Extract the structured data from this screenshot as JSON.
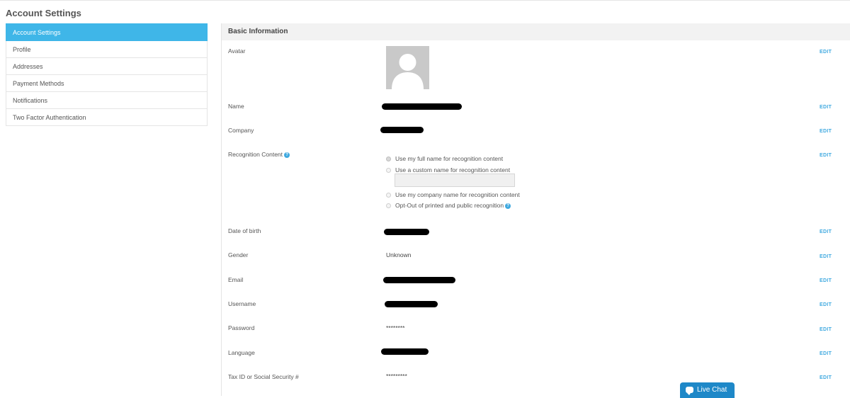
{
  "page": {
    "title": "Account Settings"
  },
  "sidebar": {
    "items": [
      {
        "label": "Account Settings",
        "active": true
      },
      {
        "label": "Profile"
      },
      {
        "label": "Addresses"
      },
      {
        "label": "Payment Methods"
      },
      {
        "label": "Notifications"
      },
      {
        "label": "Two Factor Authentication"
      }
    ]
  },
  "section": {
    "title": "Basic Information"
  },
  "fields": {
    "avatar": {
      "label": "Avatar",
      "edit": "EDIT"
    },
    "name": {
      "label": "Name",
      "edit": "EDIT"
    },
    "company": {
      "label": "Company",
      "edit": "EDIT"
    },
    "recognition": {
      "label": "Recognition Content",
      "edit": "EDIT",
      "options": [
        {
          "label": "Use my full name for recognition content",
          "checked": true
        },
        {
          "label": "Use a custom name for recognition content"
        },
        {
          "label": "Use my company name for recognition content"
        },
        {
          "label": "Opt-Out of printed and public recognition"
        }
      ],
      "custom_name_value": ""
    },
    "dob": {
      "label": "Date of birth",
      "edit": "EDIT"
    },
    "gender": {
      "label": "Gender",
      "value": "Unknown",
      "edit": "EDIT"
    },
    "email": {
      "label": "Email",
      "edit": "EDIT"
    },
    "username": {
      "label": "Username",
      "edit": "EDIT"
    },
    "password": {
      "label": "Password",
      "value": "********",
      "edit": "EDIT"
    },
    "language": {
      "label": "Language",
      "edit": "EDIT"
    },
    "tax_id": {
      "label": "Tax ID or Social Security #",
      "value": "*********",
      "edit": "EDIT"
    }
  },
  "live_chat": {
    "label": "Live Chat"
  },
  "colors": {
    "accent": "#3fb6e8",
    "link": "#3fa9e0",
    "chat": "#1e88c8"
  }
}
